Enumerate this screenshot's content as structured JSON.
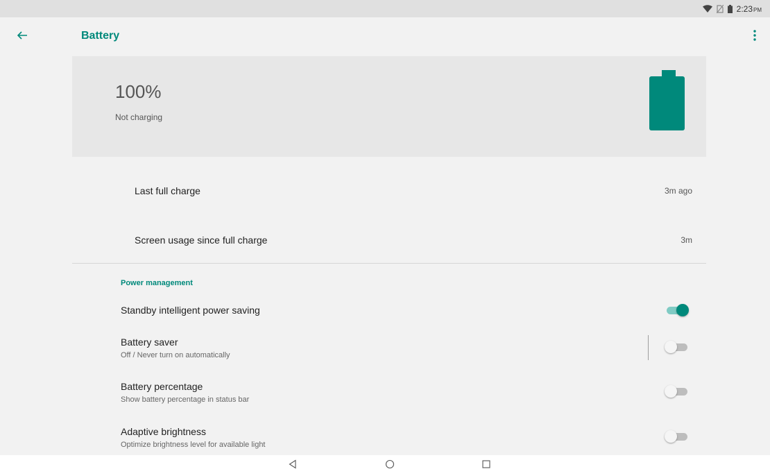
{
  "status_bar": {
    "time": "2:23",
    "ampm": "PM",
    "icons": [
      "wifi-icon",
      "no-sim-icon",
      "battery-status-icon"
    ]
  },
  "app_bar": {
    "title": "Battery",
    "back_icon": "arrow-back-icon",
    "more_icon": "more-vert-icon"
  },
  "header": {
    "level": "100%",
    "status": "Not charging",
    "battery_fill_fraction": 1.0
  },
  "info": [
    {
      "label": "Last full charge",
      "value": "3m ago"
    },
    {
      "label": "Screen usage since full charge",
      "value": "3m"
    }
  ],
  "power_management": {
    "header": "Power management",
    "items": [
      {
        "title": "Standby intelligent power saving",
        "summary": "",
        "enabled": true
      },
      {
        "title": "Battery saver",
        "summary": "Off / Never turn on automatically",
        "enabled": false
      },
      {
        "title": "Battery percentage",
        "summary": "Show battery percentage in status bar",
        "enabled": false
      },
      {
        "title": "Adaptive brightness",
        "summary": "Optimize brightness level for available light",
        "enabled": false
      }
    ]
  },
  "nav_bar": {
    "icons": [
      "back-triangle-icon",
      "home-circle-icon",
      "recents-square-icon"
    ]
  },
  "colors": {
    "accent": "#00897b",
    "accent_light": "#80cbc4",
    "background": "#f2f2f2",
    "header_card": "#e7e7e7",
    "status_bar": "#e0e0e0"
  }
}
